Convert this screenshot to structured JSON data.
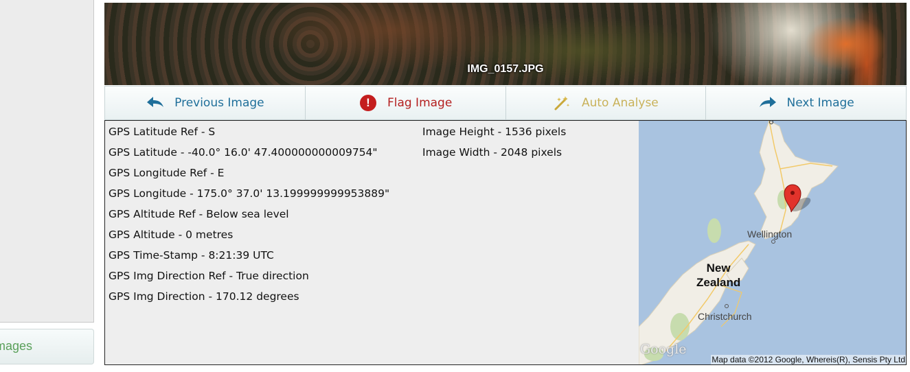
{
  "sidebar": {
    "tab_label": "Images"
  },
  "photo": {
    "filename": "IMG_0157.JPG"
  },
  "toolbar": {
    "buttons": [
      {
        "label": "Previous Image",
        "icon": "back-arrow-icon"
      },
      {
        "label": "Flag Image",
        "icon": "exclamation-icon"
      },
      {
        "label": "Auto Analyse",
        "icon": "magic-wand-icon"
      },
      {
        "label": "Next Image",
        "icon": "forward-arrow-icon"
      }
    ],
    "colors": {
      "prev": "#1f6f9a",
      "flag": "#b42020",
      "auto": "#c9b25a",
      "next": "#1f6f9a"
    }
  },
  "gps": [
    "GPS Latitude Ref - S",
    "GPS Latitude - -40.0° 16.0' 47.400000000009754\"",
    "GPS Longitude Ref - E",
    "GPS Longitude - 175.0° 37.0' 13.199999999953889\"",
    "GPS Altitude Ref - Below sea level",
    "GPS Altitude - 0 metres",
    "GPS Time-Stamp - 8:21:39 UTC",
    "GPS Img Direction Ref - True direction",
    "GPS Img Direction - 170.12 degrees"
  ],
  "image_info": [
    "Image Height - 1536 pixels",
    "Image Width - 2048 pixels"
  ],
  "map": {
    "labels": {
      "wellington": "Wellington",
      "new_zealand_line1": "New",
      "new_zealand_line2": "Zealand",
      "christchurch": "Christchurch"
    },
    "logo": "Google",
    "attribution": "Map data ©2012 Google, Whereis(R), Sensis Pty Ltd",
    "marker_icon": "map-pin-icon"
  }
}
